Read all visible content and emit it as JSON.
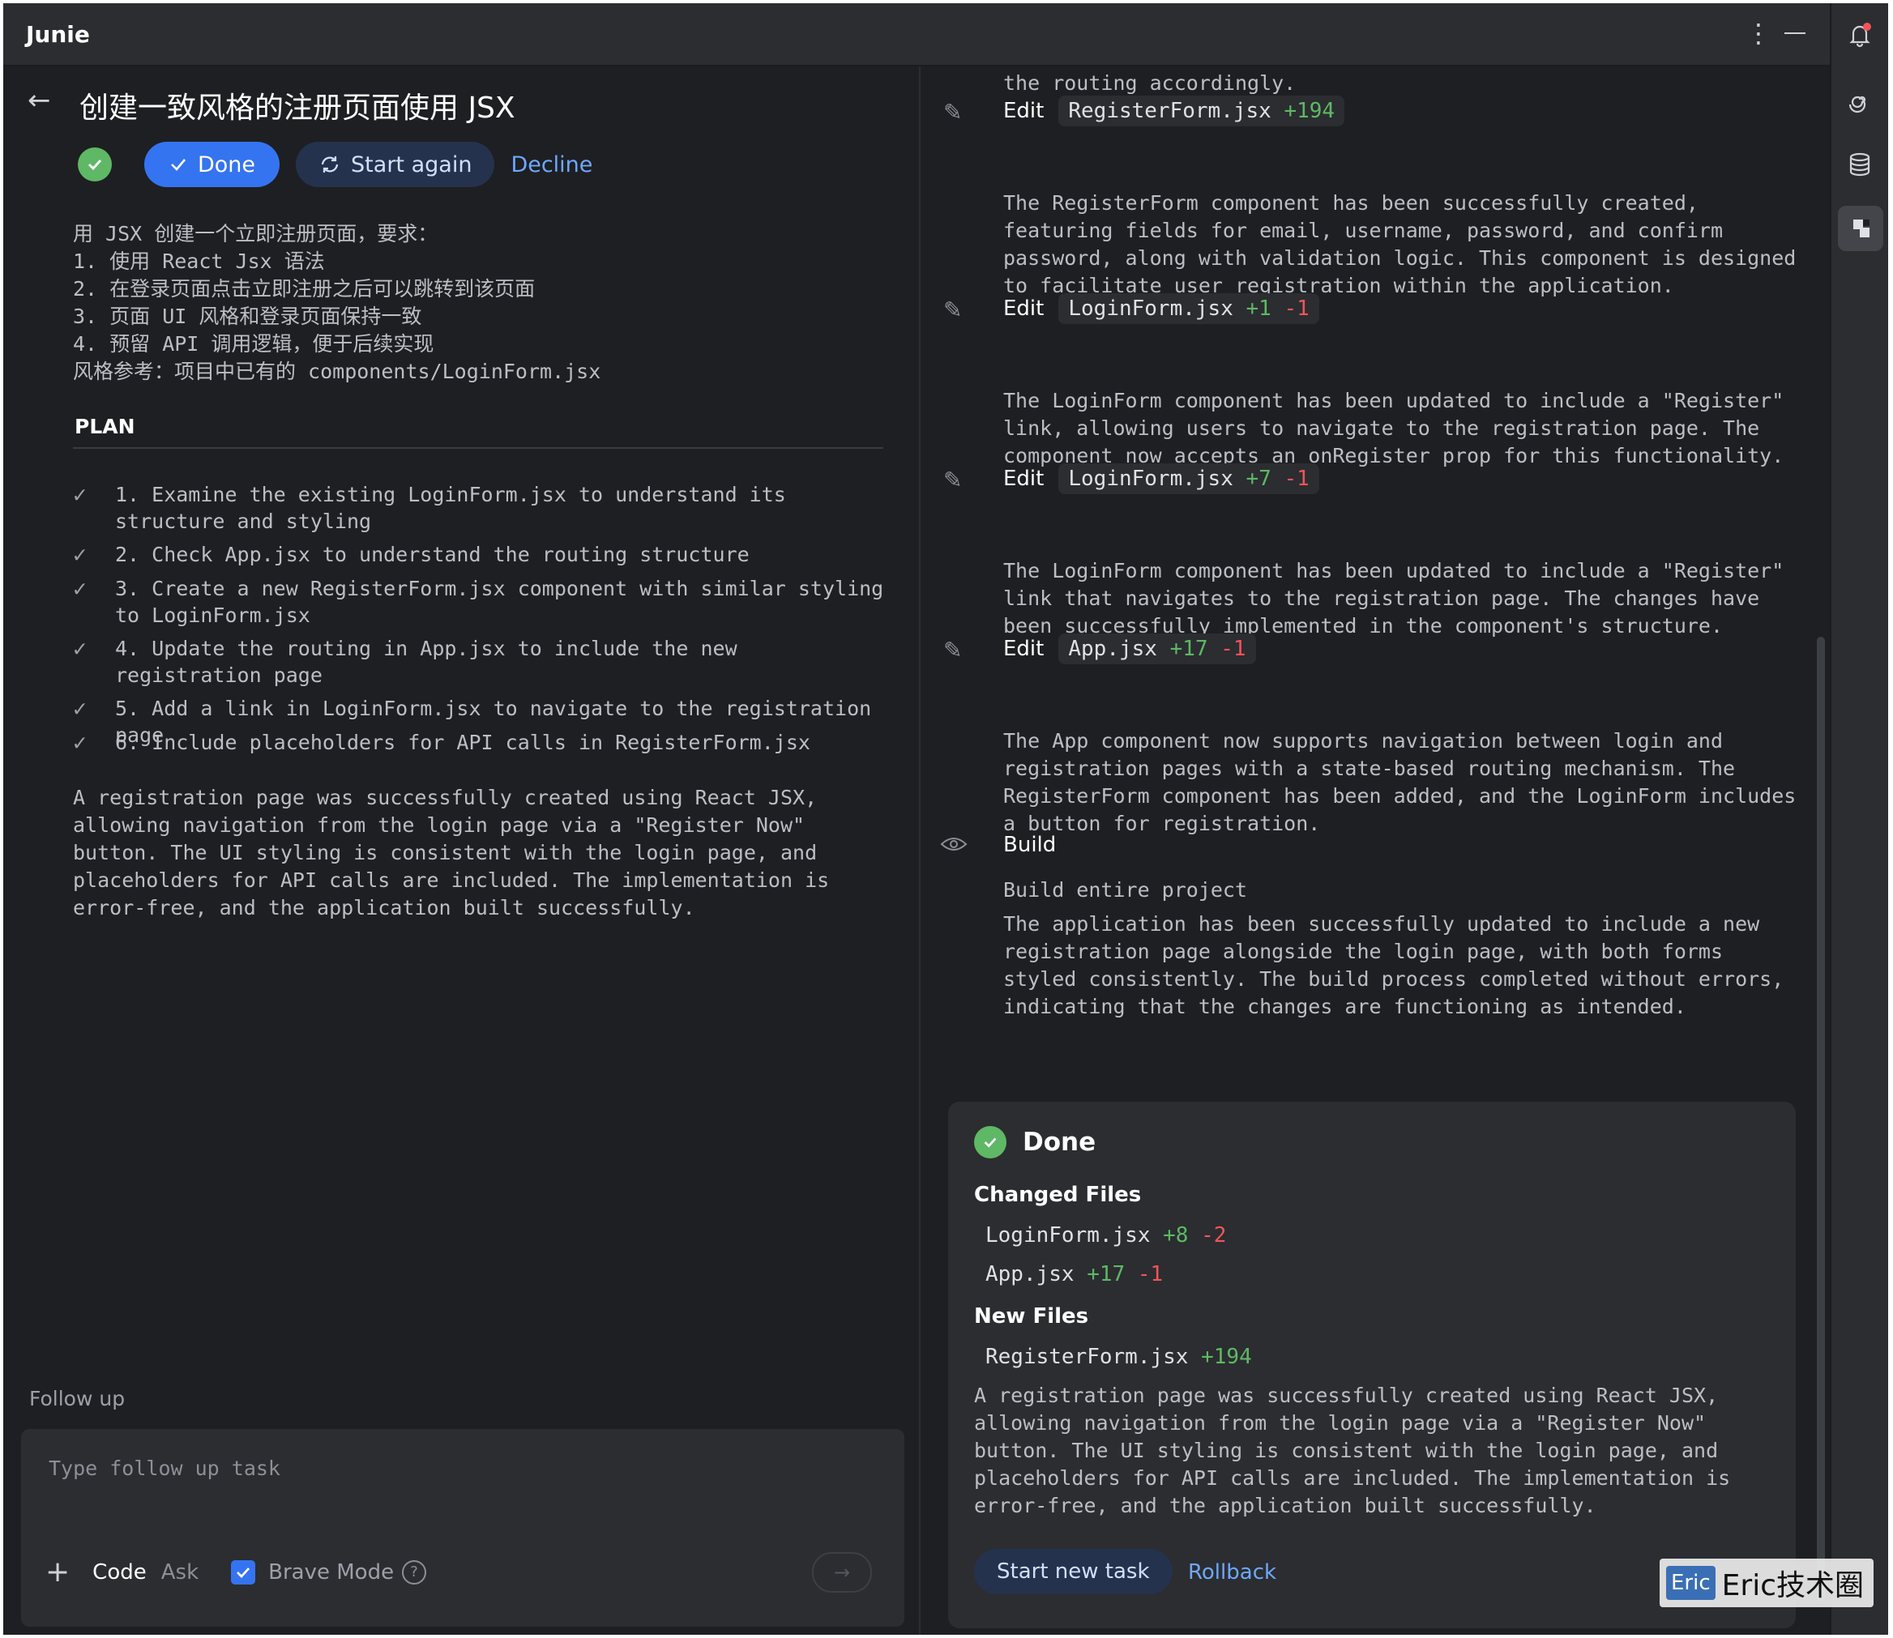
{
  "window": {
    "app_title": "Junie"
  },
  "task": {
    "title": "创建一致风格的注册页面使用 JSX",
    "done_label": "Done",
    "start_again_label": "Start again",
    "decline_label": "Decline",
    "requirements": "用 JSX 创建一个立即注册页面，要求：\n1. 使用 React Jsx 语法\n2. 在登录页面点击立即注册之后可以跳转到该页面\n3. 页面 UI 风格和登录页面保持一致\n4. 预留 API 调用逻辑，便于后续实现\n风格参考：项目中已有的 components/LoginForm.jsx"
  },
  "plan": {
    "heading": "PLAN",
    "items": [
      "1. Examine the existing LoginForm.jsx to understand its structure and styling",
      "2. Check App.jsx to understand the routing structure",
      "3. Create a new RegisterForm.jsx component with similar styling to LoginForm.jsx",
      "4. Update the routing in App.jsx to include the new registration page",
      "5. Add a link in LoginForm.jsx to navigate to the registration page",
      "6. Include placeholders for API calls in RegisterForm.jsx"
    ],
    "summary": "A registration page was successfully created using React JSX, allowing navigation from the login page via a \"Register Now\" button. The UI styling is consistent with the login page, and placeholders for API calls are included. The implementation is error-free, and the application built successfully."
  },
  "follow_up": {
    "label": "Follow up",
    "placeholder": "Type follow up task",
    "code_tab": "Code",
    "ask_tab": "Ask",
    "brave_mode": "Brave Mode",
    "brave_checked": true
  },
  "steps": {
    "top_text": "the routing accordingly.",
    "items": [
      {
        "action": "Edit",
        "file": "RegisterForm.jsx",
        "add": "+194",
        "del": "",
        "text": "The RegisterForm component has been successfully created, featuring fields for email, username, password, and confirm password, along with validation logic. This component is designed to facilitate user registration within the application."
      },
      {
        "action": "Edit",
        "file": "LoginForm.jsx",
        "add": "+1",
        "del": "-1",
        "text": "The LoginForm component has been updated to include a \"Register\" link, allowing users to navigate to the registration page. The component now accepts an onRegister prop for this functionality."
      },
      {
        "action": "Edit",
        "file": "LoginForm.jsx",
        "add": "+7",
        "del": "-1",
        "text": "The LoginForm component has been updated to include a \"Register\" link that navigates to the registration page. The changes have been successfully implemented in the component's structure."
      },
      {
        "action": "Edit",
        "file": "App.jsx",
        "add": "+17",
        "del": "-1",
        "text": "The App component now supports navigation between login and registration pages with a state-based routing mechanism. The RegisterForm component has been added, and the LoginForm includes a button for registration."
      }
    ],
    "build": {
      "action": "Build",
      "subtitle": "Build entire project",
      "text": "The application has been successfully updated to include a new registration page alongside the login page, with both forms styled consistently. The build process completed without errors, indicating that the changes are functioning as intended."
    }
  },
  "done_card": {
    "title": "Done",
    "changed_heading": "Changed Files",
    "changed_files": [
      {
        "file": "LoginForm.jsx",
        "add": "+8",
        "del": "-2"
      },
      {
        "file": "App.jsx",
        "add": "+17",
        "del": "-1"
      }
    ],
    "new_heading": "New Files",
    "new_files": [
      {
        "file": "RegisterForm.jsx",
        "add": "+194",
        "del": ""
      }
    ],
    "summary": "A registration page was successfully created using React JSX, allowing navigation from the login page via a \"Register Now\" button. The UI styling is consistent with the login page, and placeholders for API calls are included. The implementation is error-free, and the application built successfully.",
    "start_new_label": "Start new task",
    "rollback_label": "Rollback"
  },
  "watermark": {
    "logo": "Eric",
    "text": "Eric技术圈"
  },
  "colors": {
    "accent": "#3574f0",
    "success": "#5fb865",
    "danger": "#f2545b",
    "link": "#6ea8ff"
  },
  "icons": [
    "back-arrow-icon",
    "check-circle-icon",
    "checkmark-icon",
    "refresh-icon",
    "pencil-icon",
    "eye-icon",
    "bell-icon",
    "spiral-icon",
    "database-icon",
    "junie-icon",
    "plus-icon",
    "question-icon",
    "send-arrow-icon",
    "kebab-icon",
    "minimize-icon"
  ]
}
